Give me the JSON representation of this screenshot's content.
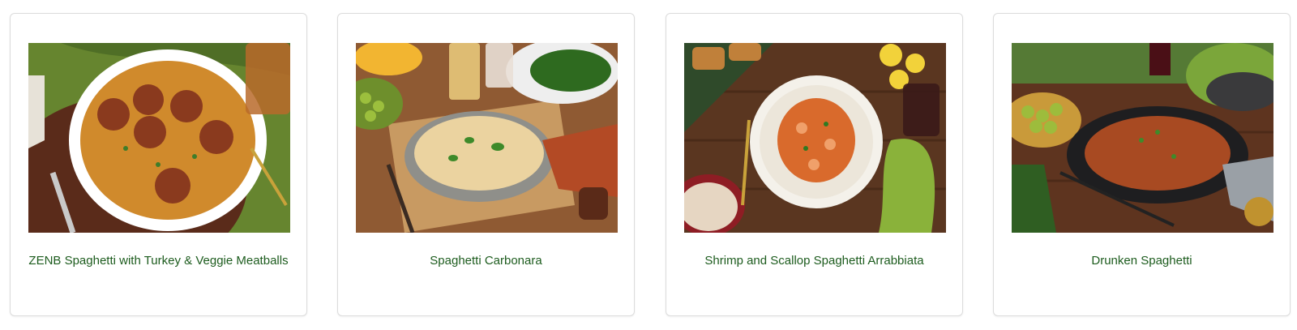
{
  "recipes": [
    {
      "title": "ZENB Spaghetti with Turkey & Veggie Meatballs",
      "image_icon": "spaghetti-meatballs-photo-icon"
    },
    {
      "title": "Spaghetti Carbonara",
      "image_icon": "spaghetti-carbonara-photo-icon"
    },
    {
      "title": "Shrimp and Scallop Spaghetti Arrabbiata",
      "image_icon": "shrimp-scallop-arrabbiata-photo-icon"
    },
    {
      "title": "Drunken Spaghetti",
      "image_icon": "drunken-spaghetti-photo-icon"
    }
  ],
  "colors": {
    "title_text": "#1d5c1e",
    "card_border": "#dcdcdc",
    "background": "#ffffff"
  }
}
